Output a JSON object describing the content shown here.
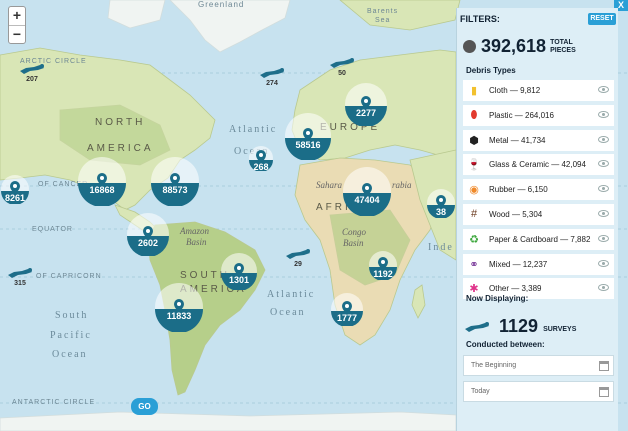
{
  "map": {
    "labels": {
      "greenland": "Greenland",
      "north_america_1": "NORTH",
      "north_america_2": "AMERICA",
      "south_america_1": "SOUTH",
      "south_america_2": "AMERICA",
      "europe": "EUROPE",
      "africa": "AFRICA",
      "atlantic_n": "Atlantic",
      "atlantic_o": "Ocean",
      "atlantic_s": "Atlantic",
      "atlantic_s2": "Ocean",
      "south_pacific_1": "South",
      "south_pacific_2": "Pacific",
      "south_pacific_3": "Ocean",
      "indian": "Inde",
      "sahara": "Sahara",
      "arabia": "rabia",
      "congo": "Congo",
      "basin": "Basin",
      "amazon": "Amazon",
      "amazon_basin": "Basin",
      "arctic_circle": "ARCTIC CIRCLE",
      "tropic_cancer": "OF CANCER",
      "equator": "EQUATOR",
      "tropic_capricorn": "OF CAPRICORN",
      "antarctic_circle": "ANTARCTIC CIRCLE",
      "barents": "Barents",
      "sea": "Sea"
    },
    "clusters": [
      {
        "name": "north-america-west",
        "label": "8261"
      },
      {
        "name": "north-america-central",
        "label": "16868"
      },
      {
        "name": "north-america-east",
        "label": "88573"
      },
      {
        "name": "central-america",
        "label": "2602"
      },
      {
        "name": "south-america-east",
        "label": "1301"
      },
      {
        "name": "south-america-south",
        "label": "11833"
      },
      {
        "name": "europe-west",
        "label": "58516"
      },
      {
        "name": "europe-north",
        "label": "2277"
      },
      {
        "name": "atlantic-mid",
        "label": "268"
      },
      {
        "name": "africa-north",
        "label": "47404"
      },
      {
        "name": "africa-east",
        "label": "1192"
      },
      {
        "name": "africa-south",
        "label": "1777"
      },
      {
        "name": "asia-south",
        "label": "38"
      }
    ],
    "divers": [
      {
        "name": "alaska",
        "label": "207"
      },
      {
        "name": "greenland-sea",
        "label": "274"
      },
      {
        "name": "barents",
        "label": "50"
      },
      {
        "name": "south-atlantic",
        "label": "29"
      },
      {
        "name": "pacific",
        "label": "315"
      }
    ]
  },
  "zoom": {
    "in": "+",
    "out": "−"
  },
  "panel": {
    "close": "X",
    "title": "FILTERS:",
    "reset": "RESET",
    "total_value": "392,618",
    "total_label": "TOTAL PIECES",
    "debris_heading": "Debris Types",
    "types": [
      {
        "label": "Cloth — 9,812",
        "icon": "cloth-icon",
        "color": "#f2c12e"
      },
      {
        "label": "Plastic — 264,016",
        "icon": "bottle-icon",
        "color": "#e23a2e"
      },
      {
        "label": "Metal — 41,734",
        "icon": "hex-nut-icon",
        "color": "#222222"
      },
      {
        "label": "Glass & Ceramic — 42,094",
        "icon": "wine-glass-icon",
        "color": "#2a2f8f"
      },
      {
        "label": "Rubber — 6,150",
        "icon": "rubber-icon",
        "color": "#f08a2b"
      },
      {
        "label": "Wood — 5,304",
        "icon": "wood-icon",
        "color": "#6b3a1e"
      },
      {
        "label": "Paper & Cardboard — 7,882",
        "icon": "recycle-icon",
        "color": "#3aa63a"
      },
      {
        "label": "Mixed — 12,237",
        "icon": "mixed-icon",
        "color": "#7a3a9a"
      },
      {
        "label": "Other — 3,389",
        "icon": "asterisk-icon",
        "color": "#e0338a"
      }
    ],
    "now_heading": "Now Displaying:",
    "surveys_value": "1129",
    "surveys_label": "SURVEYS",
    "conducted_heading": "Conducted between:",
    "start_placeholder": "The Beginning",
    "end_placeholder": "Today",
    "go": "GO"
  }
}
